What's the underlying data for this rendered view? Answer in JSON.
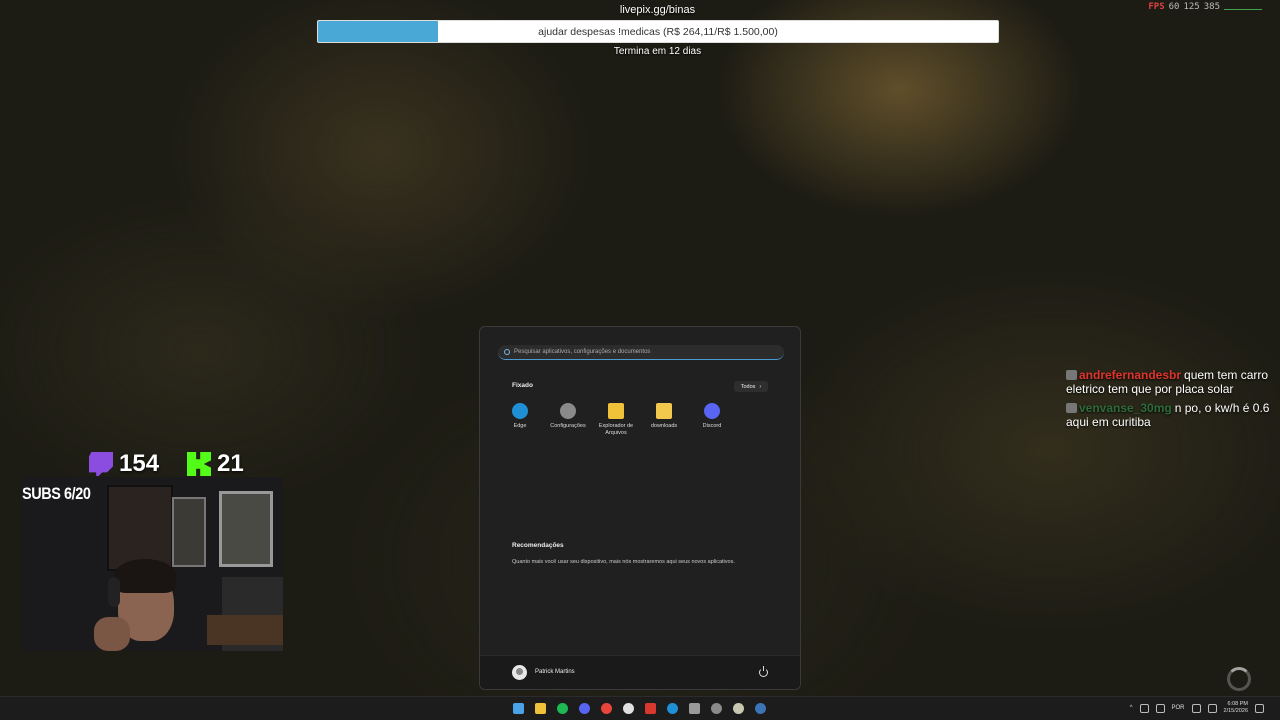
{
  "overlay": {
    "goal_url": "livepix.gg/binas",
    "goal_text": "ajudar despesas !medicas (R$ 264,11/R$ 1.500,00)",
    "goal_progress_percent": 17.6,
    "goal_ends": "Termina em 12 dias",
    "fps_label": "FPS",
    "fps_value": "60",
    "fps_low": "125",
    "fps_high": "385"
  },
  "start_menu": {
    "search_placeholder": "Pesquisar aplicativos, configurações e documentos",
    "pinned_title": "Fixado",
    "all_button": "Todos",
    "all_chevron": "›",
    "pinned_apps": [
      {
        "label": "Edge",
        "icon": "edge-icon",
        "color": "#1f8fd6"
      },
      {
        "label": "Configurações",
        "icon": "settings-gear-icon",
        "color": "#8a8a8a"
      },
      {
        "label": "Explorador de Arquivos",
        "icon": "file-explorer-icon",
        "color": "#f0c23a"
      },
      {
        "label": "downloads",
        "icon": "folder-icon",
        "color": "#f2c94c"
      },
      {
        "label": "Discord",
        "icon": "discord-icon",
        "color": "#5865f2"
      }
    ],
    "recommendations_title": "Recomendações",
    "recommendations_text": "Quanto mais você usar seu dispositivo, mais nós mostraremos aqui seus novos aplicativos.",
    "user_name": "Patrick Martins"
  },
  "stream": {
    "twitch_count": "154",
    "kick_count": "21",
    "subs": "SUBS 6/20"
  },
  "chat": [
    {
      "user": "andrefernandesbr",
      "color": "#e0342c",
      "message": "quem tem carro eletrico tem que por placa solar"
    },
    {
      "user": "venvanse_30mg",
      "color": "#2e6b3a",
      "message": "n po, o kw/h é 0.6 aqui em curitiba"
    }
  ],
  "taskbar": {
    "apps": [
      {
        "icon": "windows-start-icon",
        "color": "#4aa3e8"
      },
      {
        "icon": "file-explorer-icon",
        "color": "#f0c23a"
      },
      {
        "icon": "spotify-icon",
        "color": "#1db954"
      },
      {
        "icon": "discord-icon",
        "color": "#5865f2"
      },
      {
        "icon": "chrome-icon",
        "color": "#e8453c"
      },
      {
        "icon": "obs-icon",
        "color": "#e0e0e0"
      },
      {
        "icon": "app-red-icon",
        "color": "#d8382e"
      },
      {
        "icon": "edge-icon",
        "color": "#1f8fd6"
      },
      {
        "icon": "gamepad-icon",
        "color": "#9a9a9a"
      },
      {
        "icon": "settings-gear-icon",
        "color": "#8a8a8a"
      },
      {
        "icon": "eye-app-icon",
        "color": "#c8c8b0"
      },
      {
        "icon": "steam-icon",
        "color": "#3c74b8"
      }
    ],
    "tray": {
      "language": "POR",
      "time": "6:08 PM",
      "date": "2/15/2026"
    }
  }
}
